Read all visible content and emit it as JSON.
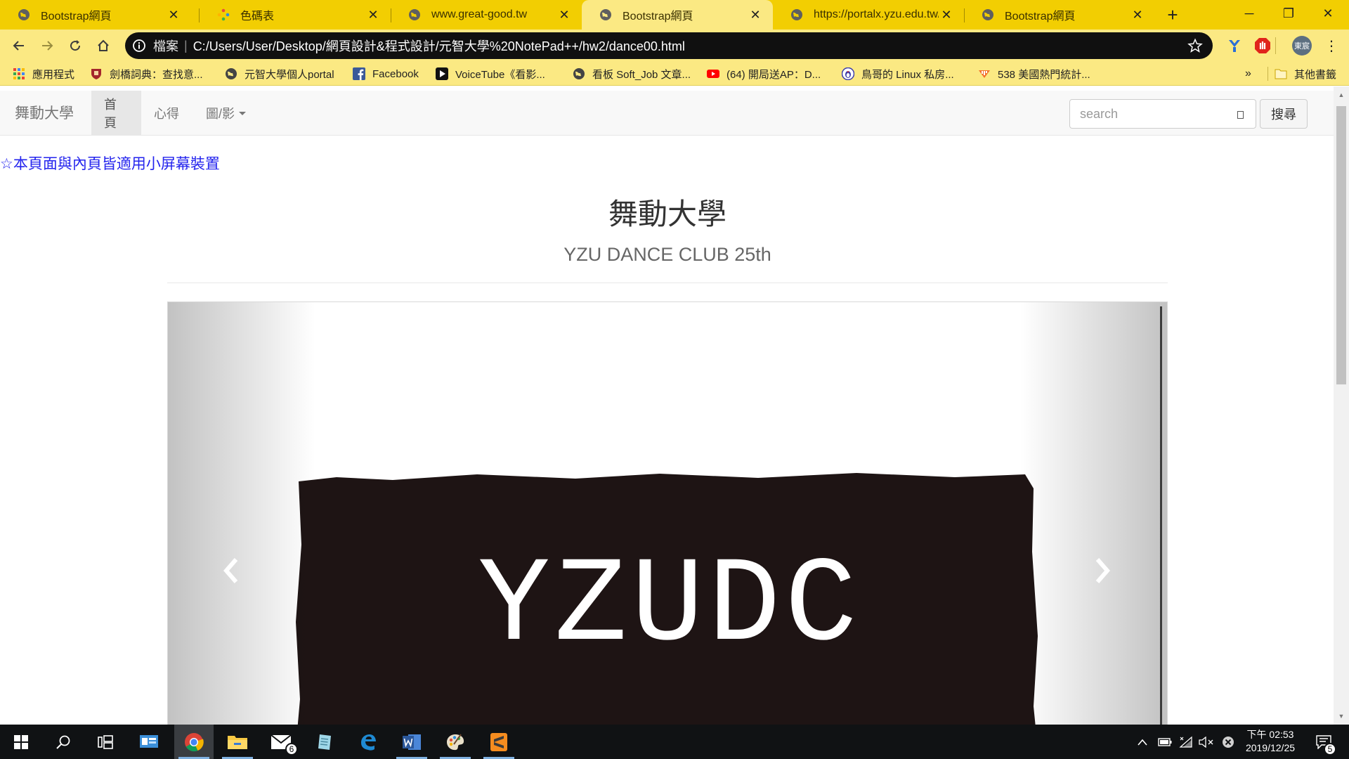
{
  "browser": {
    "tabs": [
      {
        "title": "Bootstrap網頁",
        "icon": "globe-icon",
        "active": false
      },
      {
        "title": "色碼表",
        "icon": "color-dots-icon",
        "active": false
      },
      {
        "title": "www.great-good.tw",
        "icon": "globe-icon",
        "active": false
      },
      {
        "title": "Bootstrap網頁",
        "icon": "globe-icon",
        "active": true
      },
      {
        "title": "https://portalx.yzu.edu.tw/",
        "icon": "globe-icon",
        "active": false
      },
      {
        "title": "Bootstrap網頁",
        "icon": "globe-icon",
        "active": false
      }
    ],
    "tab_close_glyph": "✕",
    "new_tab_glyph": "+",
    "window_controls": {
      "minimize": "─",
      "restore": "❐",
      "close": "✕"
    },
    "address": {
      "scheme_label": "檔案",
      "separator": "|",
      "url": "C:/Users/User/Desktop/網頁設計&程式設計/元智大學%20NotePad++/hw2/dance00.html"
    },
    "profile_initials": "東宸",
    "menu_glyph": "⋮",
    "bookmarks": [
      {
        "label": "應用程式",
        "icon": "apps-grid-icon"
      },
      {
        "label": "劍橋詞典：查找意...",
        "icon": "cambridge-shield-icon"
      },
      {
        "label": "元智大學個人portal",
        "icon": "globe-icon"
      },
      {
        "label": "Facebook",
        "icon": "facebook-icon"
      },
      {
        "label": "VoiceTube《看影...",
        "icon": "voicetube-icon"
      },
      {
        "label": "看板 Soft_Job 文章...",
        "icon": "globe-icon"
      },
      {
        "label": "(64) 開局送AP：D...",
        "icon": "youtube-icon"
      },
      {
        "label": "鳥哥的 Linux 私房...",
        "icon": "penguin-icon"
      },
      {
        "label": "538 美國熱門統計...",
        "icon": "fivethirtyeight-icon"
      }
    ],
    "bookmarks_overflow": "»",
    "other_bookmarks": "其他書籤"
  },
  "page": {
    "brand": "舞動大學",
    "nav": [
      {
        "label": "首頁",
        "active": true
      },
      {
        "label": "心得",
        "active": false
      },
      {
        "label": "圖/影",
        "active": false,
        "dropdown": true
      }
    ],
    "search": {
      "placeholder": "search",
      "button": "搜尋"
    },
    "notice": "☆本頁面與內頁皆適用小屏幕裝置",
    "heading": "舞動大學",
    "subheading": "YZU DANCE CLUB 25th",
    "carousel": {
      "slide_text": "YZUDC"
    }
  },
  "taskbar": {
    "mail_badge": "6",
    "clock_time": "下午 02:53",
    "clock_date": "2019/12/25",
    "notification_count": "5"
  },
  "colors": {
    "tab_strip": "#f2ce02",
    "toolbar": "#fbe983",
    "link_blue": "#2424ee",
    "board": "#1e1414",
    "taskbar": "#101214"
  }
}
